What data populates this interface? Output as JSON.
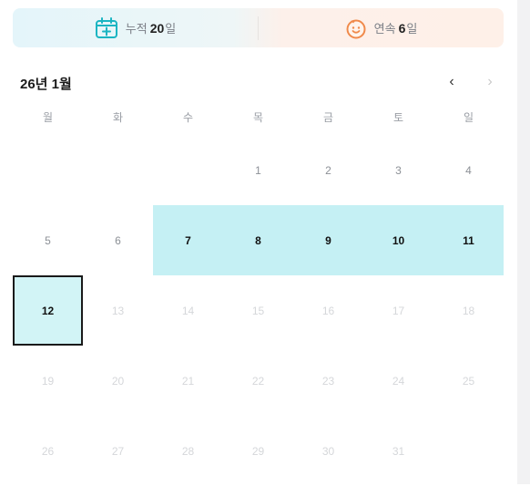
{
  "stats": {
    "total_label": "누적",
    "total_value": "20",
    "total_unit": "일",
    "total_icon": "calendar-plus-icon",
    "streak_label": "연속",
    "streak_value": "6",
    "streak_unit": "일",
    "streak_icon": "smiley-icon"
  },
  "calendar": {
    "month_title": "26년 1월",
    "prev_symbol": "‹",
    "next_symbol": "›",
    "weekdays": [
      "월",
      "화",
      "수",
      "목",
      "금",
      "토",
      "일"
    ],
    "days": [
      {
        "label": "",
        "state": "blank"
      },
      {
        "label": "",
        "state": "blank"
      },
      {
        "label": "",
        "state": "blank"
      },
      {
        "label": "1",
        "state": "normal"
      },
      {
        "label": "2",
        "state": "normal"
      },
      {
        "label": "3",
        "state": "normal"
      },
      {
        "label": "4",
        "state": "normal"
      },
      {
        "label": "5",
        "state": "normal"
      },
      {
        "label": "6",
        "state": "normal"
      },
      {
        "label": "7",
        "state": "streak"
      },
      {
        "label": "8",
        "state": "streak"
      },
      {
        "label": "9",
        "state": "streak"
      },
      {
        "label": "10",
        "state": "streak"
      },
      {
        "label": "11",
        "state": "streak"
      },
      {
        "label": "12",
        "state": "today"
      },
      {
        "label": "13",
        "state": "future"
      },
      {
        "label": "14",
        "state": "future"
      },
      {
        "label": "15",
        "state": "future"
      },
      {
        "label": "16",
        "state": "future"
      },
      {
        "label": "17",
        "state": "future"
      },
      {
        "label": "18",
        "state": "future"
      },
      {
        "label": "19",
        "state": "future"
      },
      {
        "label": "20",
        "state": "future"
      },
      {
        "label": "21",
        "state": "future"
      },
      {
        "label": "22",
        "state": "future"
      },
      {
        "label": "23",
        "state": "future"
      },
      {
        "label": "24",
        "state": "future"
      },
      {
        "label": "25",
        "state": "future"
      },
      {
        "label": "26",
        "state": "future"
      },
      {
        "label": "27",
        "state": "future"
      },
      {
        "label": "28",
        "state": "future"
      },
      {
        "label": "29",
        "state": "future"
      },
      {
        "label": "30",
        "state": "future"
      },
      {
        "label": "31",
        "state": "future"
      }
    ]
  },
  "colors": {
    "streak_fill": "#c5f0f4",
    "today_border": "#1a1a1a",
    "calendar_icon": "#1bb5c2",
    "smiley_icon": "#f08a4b"
  }
}
